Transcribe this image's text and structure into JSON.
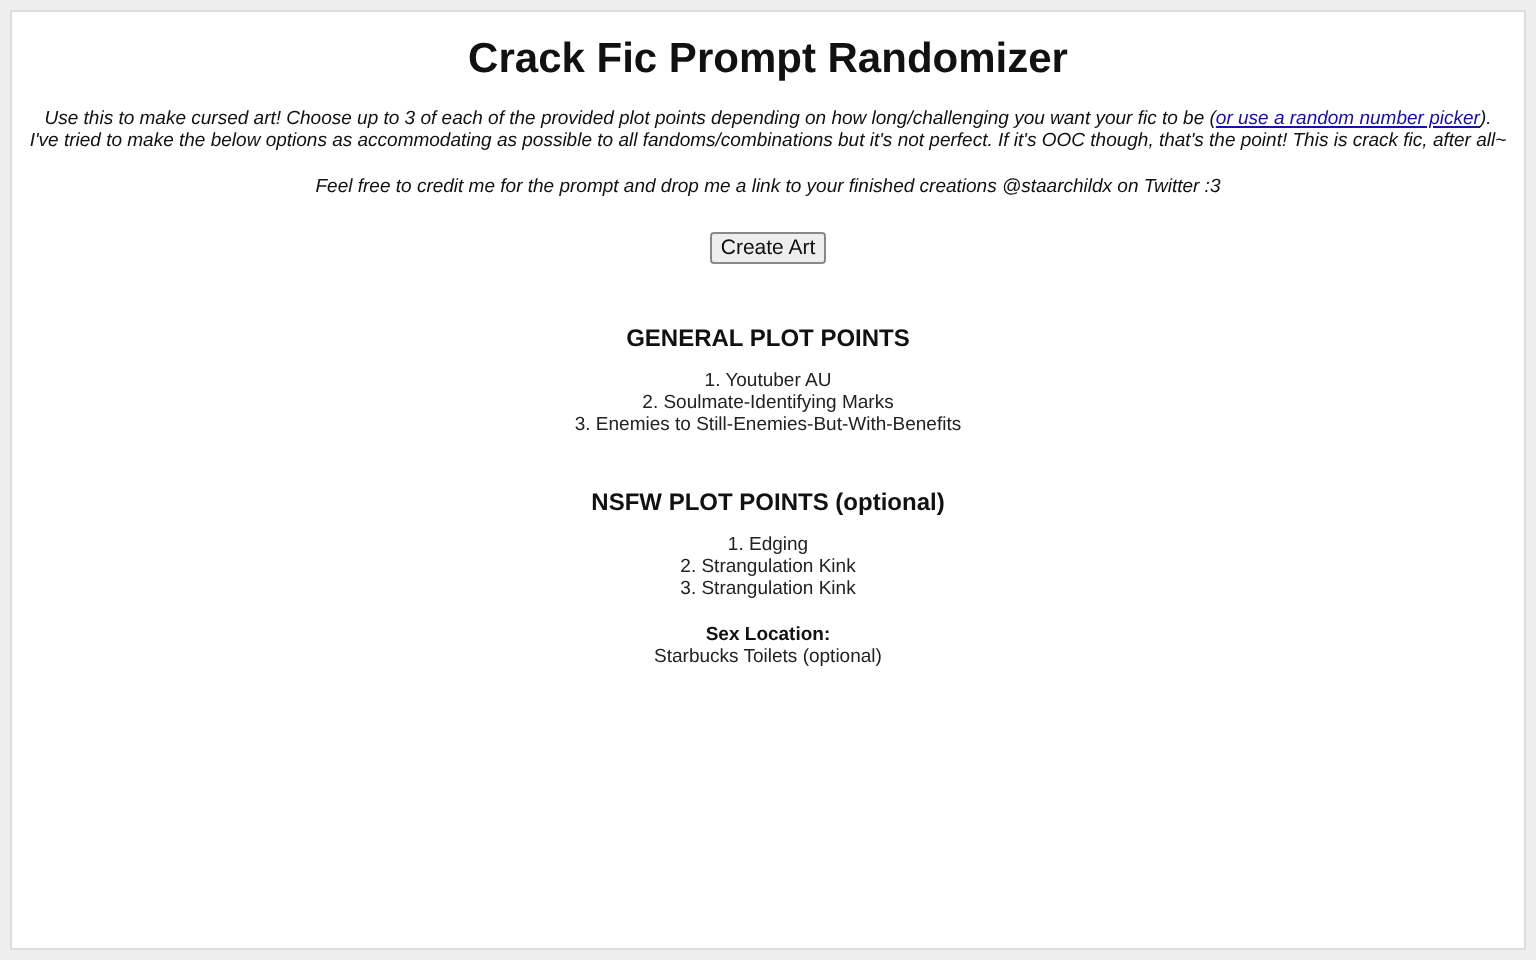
{
  "title": "Crack Fic Prompt Randomizer",
  "intro": {
    "before": "Use this to make cursed art! Choose up to 3 of each of the provided plot points depending on how long/challenging you want your fic to be (",
    "link": "or use a random number picker",
    "after": ").",
    "line2": "I've tried to make the below options as accommodating as possible to all fandoms/combinations but it's not perfect. If it's OOC though, that's the point! This is crack fic, after all~"
  },
  "credit": "Feel free to credit me for the prompt and drop me a link to your finished creations @staarchildx on Twitter :3",
  "button": "Create Art",
  "sections": [
    {
      "heading": "GENERAL PLOT POINTS",
      "items": [
        "1. Youtuber AU",
        "2. Soulmate-Identifying Marks",
        "3. Enemies to Still-Enemies-But-With-Benefits"
      ]
    },
    {
      "heading": "NSFW PLOT POINTS (optional)",
      "items": [
        "1. Edging",
        "2. Strangulation Kink",
        "3. Strangulation Kink"
      ],
      "location_label": "Sex Location:",
      "location": "Starbucks Toilets (optional)"
    }
  ]
}
